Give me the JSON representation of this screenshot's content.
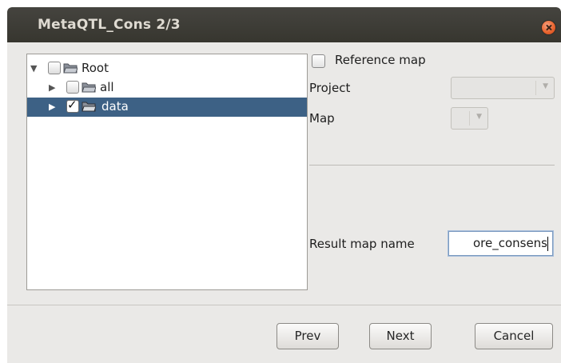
{
  "window": {
    "title": "MetaQTL_Cons 2/3"
  },
  "tree": {
    "nodes": [
      {
        "label": "Root",
        "expanded": true,
        "checked": false,
        "selected": false
      },
      {
        "label": "all",
        "expanded": false,
        "checked": false,
        "selected": false
      },
      {
        "label": "data",
        "expanded": false,
        "checked": true,
        "selected": true
      }
    ]
  },
  "options": {
    "reference_map_label": "Reference map",
    "reference_map_checked": false,
    "project_label": "Project",
    "project_value": "",
    "map_label": "Map",
    "map_value": "",
    "result_map_label": "Result map name",
    "result_map_value": "ore_consens"
  },
  "buttons": {
    "prev": "Prev",
    "next": "Next",
    "cancel": "Cancel"
  },
  "icons": {
    "close": "close-icon",
    "expand": "triangle-down-icon",
    "collapse": "triangle-right-icon",
    "folder": "folder-icon",
    "combo_arrow": "chevron-down-icon"
  },
  "colors": {
    "titlebar": "#3c3b37",
    "window_bg": "#eae9e7",
    "selection": "#3d6185",
    "close_button": "#e9652f"
  }
}
